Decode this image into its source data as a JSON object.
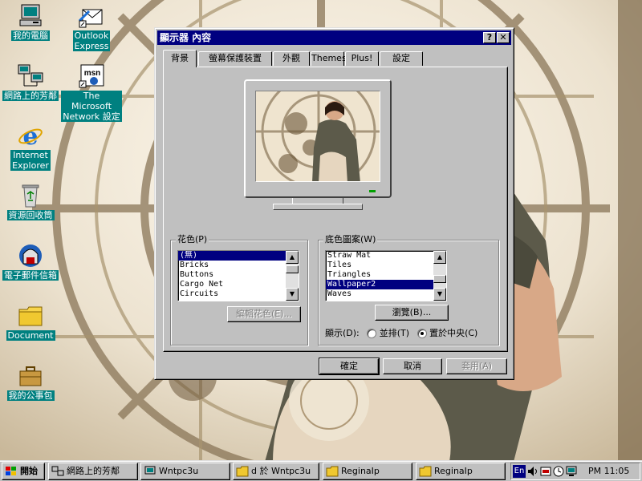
{
  "desktop": {
    "icons": [
      {
        "label": "我的電腦",
        "icon": "my-computer-icon"
      },
      {
        "label": "網路上的芳鄰",
        "icon": "network-neighborhood-icon"
      },
      {
        "label": "Internet Explorer",
        "line1": "Internet",
        "line2": "Explorer",
        "icon": "internet-explorer-icon"
      },
      {
        "label": "資源回收筒",
        "icon": "recycle-bin-icon"
      },
      {
        "label": "電子郵件信箱",
        "icon": "inbox-icon"
      },
      {
        "label": "Document",
        "icon": "folder-icon"
      },
      {
        "label": "我的公事包",
        "icon": "briefcase-icon"
      },
      {
        "label": "Outlook Express",
        "line1": "Outlook",
        "line2": "Express",
        "icon": "outlook-express-icon"
      },
      {
        "label": "The Microsoft Network 設定",
        "line1": "The Microsoft",
        "line2": "Network 設定",
        "icon": "msn-icon"
      }
    ]
  },
  "dialog": {
    "title": "顯示器 內容",
    "help_btn": "?",
    "close_btn": "✕",
    "tabs": [
      "背景",
      "螢幕保護裝置",
      "外觀",
      "Themes",
      "Plus!",
      "設定"
    ],
    "active_tab": "背景",
    "pattern": {
      "label": "花色(P)",
      "items": [
        "(無)",
        "Bricks",
        "Buttons",
        "Cargo Net",
        "Circuits"
      ],
      "selected": "(無)",
      "edit_button": "編輯花色(E)..."
    },
    "wallpaper": {
      "label": "底色圖案(W)",
      "items": [
        "Straw Mat",
        "Tiles",
        "Triangles",
        "Wallpaper2",
        "Waves"
      ],
      "selected": "Wallpaper2",
      "browse_button": "瀏覽(B)..."
    },
    "display": {
      "label": "顯示(D):",
      "tile_option": "並排(T)",
      "center_option": "置於中央(C)",
      "selected": "置於中央(C)"
    },
    "buttons": {
      "ok": "確定",
      "cancel": "取消",
      "apply": "套用(A)"
    }
  },
  "taskbar": {
    "start_label": "開始",
    "tasks": [
      "網路上的芳鄰",
      "Wntpc3u",
      "d 於 Wntpc3u",
      "ReginaIp",
      "ReginaIp"
    ],
    "tray": {
      "lang": "En",
      "clock": "PM 11:05"
    }
  },
  "colors": {
    "desktop_label_bg": "#008080",
    "title_bar": "#000080",
    "selection": "#000080",
    "face": "#c0c0c0"
  }
}
